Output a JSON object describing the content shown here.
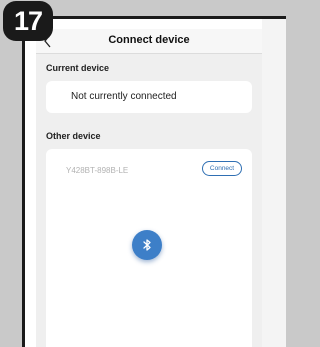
{
  "step_badge": "17",
  "navbar": {
    "title": "Connect device",
    "back_icon": "chevron-left-icon"
  },
  "current_device": {
    "section_label": "Current device",
    "status": "Not currently connected"
  },
  "other_device": {
    "section_label": "Other device",
    "devices": [
      {
        "name": "Y428BT-898B-LE",
        "action_label": "Connect"
      }
    ],
    "bluetooth_icon": "bluetooth-icon"
  },
  "colors": {
    "accent": "#3d7fc8",
    "badge": "#1a1a1a",
    "background": "#efefef"
  }
}
